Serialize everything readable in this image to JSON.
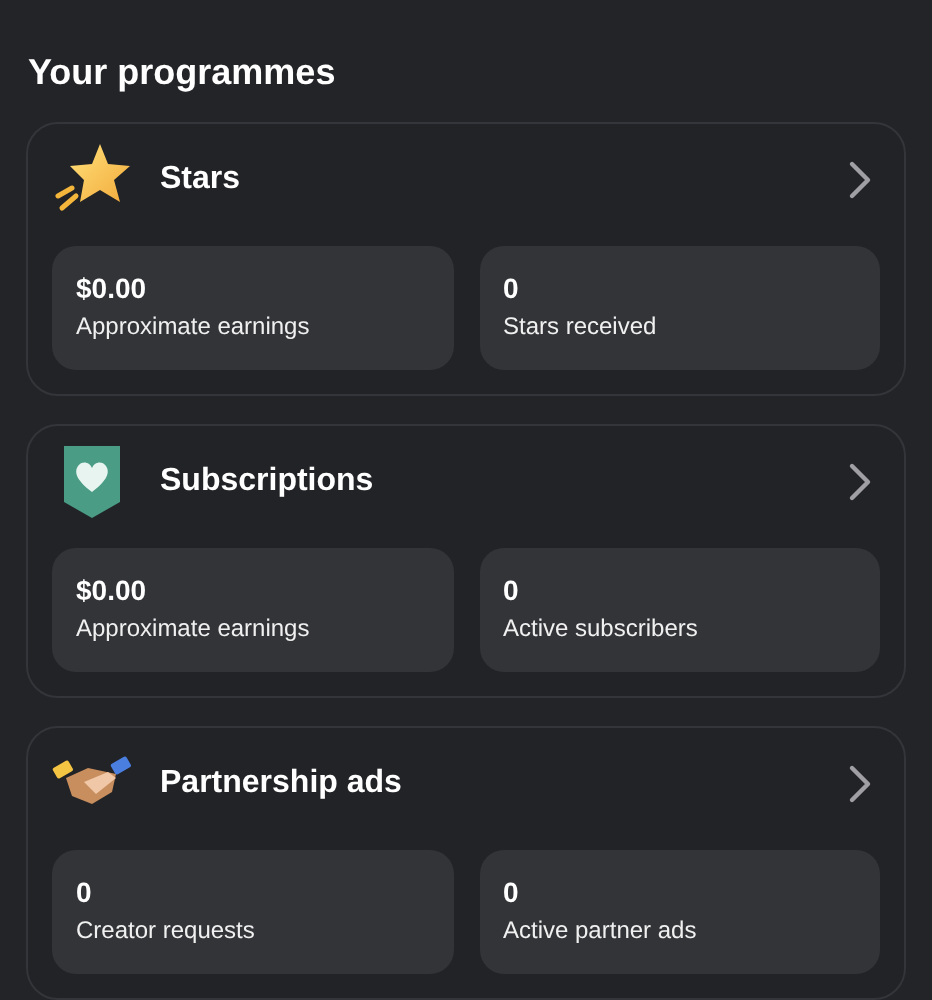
{
  "heading": "Your programmes",
  "programmes": [
    {
      "kind": "stars",
      "title": "Stars",
      "stats": [
        {
          "value": "$0.00",
          "label": "Approximate earnings"
        },
        {
          "value": "0",
          "label": "Stars received"
        }
      ]
    },
    {
      "kind": "subscriptions",
      "title": "Subscriptions",
      "stats": [
        {
          "value": "$0.00",
          "label": "Approximate earnings"
        },
        {
          "value": "0",
          "label": "Active subscribers"
        }
      ]
    },
    {
      "kind": "partnership",
      "title": "Partnership ads",
      "stats": [
        {
          "value": "0",
          "label": "Creator requests"
        },
        {
          "value": "0",
          "label": "Active partner ads"
        }
      ]
    }
  ]
}
